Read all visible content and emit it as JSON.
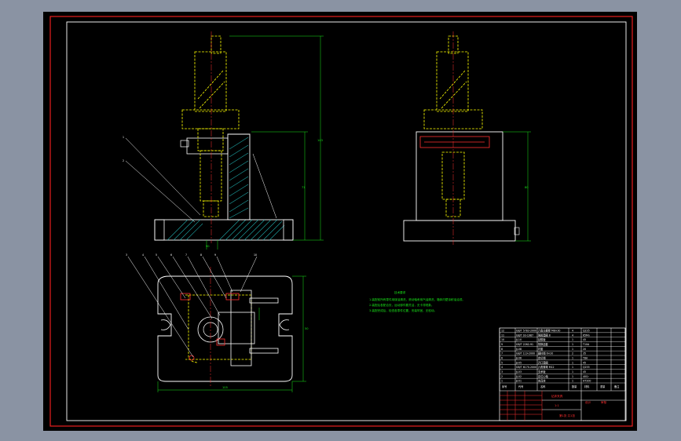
{
  "colors": {
    "background": "#8a93a3",
    "paper": "#000000",
    "frame": "#ff2020",
    "outline": "#ffffff",
    "part": "#ffff00",
    "dimension": "#19e619",
    "section_fill": "#1ea5a5",
    "center_line": "#ff3030",
    "text": "#19e619"
  },
  "drawing": {
    "tech_title": "技术要求",
    "tech_lines": [
      "1.装配前所有零件用煤油清洗，滚动轴承用汽油清洗，箱体内壁涂耐油油漆。",
      "2.装配后各配合处，运动部件要灵活，无卡滞现象。",
      "3.装配完成后，检查各零件位置，安装牢固，无松动。"
    ],
    "dims": {
      "front_total_height": "143",
      "front_body_height": "71",
      "front_base_width": "90",
      "side_body_height": "80",
      "plan_width": "105",
      "plan_depth": "50"
    },
    "balloons_front": [
      "1",
      "2"
    ],
    "balloons_plan": [
      "3",
      "4",
      "5",
      "6",
      "7",
      "8",
      "9",
      "10"
    ]
  },
  "title_block": {
    "parts": [
      {
        "no": "12",
        "code": "GB/T 5783-2000",
        "name": "六角头螺栓 M8×30",
        "qty": "4",
        "mat": "Q235"
      },
      {
        "no": "11",
        "code": "GB/T 93-1987",
        "name": "弹簧垫圈 8",
        "qty": "4",
        "mat": "65Mn"
      },
      {
        "no": "10",
        "code": "JJ-10",
        "name": "钻模板",
        "qty": "1",
        "mat": "45"
      },
      {
        "no": "9",
        "code": "GB/T 2262-91",
        "name": "快换钻套",
        "qty": "1",
        "mat": "T10A"
      },
      {
        "no": "8",
        "code": "JJ-08",
        "name": "衬套",
        "qty": "1",
        "mat": "20"
      },
      {
        "no": "7",
        "code": "GB/T 119-2000",
        "name": "圆柱销 6×20",
        "qty": "2",
        "mat": "35"
      },
      {
        "no": "6",
        "code": "JJ-06",
        "name": "定位销",
        "qty": "1",
        "mat": "T8A"
      },
      {
        "no": "5",
        "code": "JJ-05",
        "name": "开口垫圈",
        "qty": "1",
        "mat": "45"
      },
      {
        "no": "4",
        "code": "GB/T 6170-2000",
        "name": "六角螺母 M12",
        "qty": "1",
        "mat": "Q235"
      },
      {
        "no": "3",
        "code": "JJ-03",
        "name": "支承板",
        "qty": "1",
        "mat": "45"
      },
      {
        "no": "2",
        "code": "JJ-02",
        "name": "定位心轴",
        "qty": "1",
        "mat": "40Cr"
      },
      {
        "no": "1",
        "code": "JJ-01",
        "name": "夹具体",
        "qty": "1",
        "mat": "HT200"
      }
    ],
    "headers": {
      "no": "序号",
      "code": "代号",
      "name": "名称",
      "qty": "数量",
      "mat": "材料",
      "weight": "重量",
      "note": "备注"
    },
    "drawing_name": "钻床夹具",
    "scale": "1:1",
    "sheet": "第1张 共1张",
    "designer": "设计",
    "checker": "审核"
  }
}
